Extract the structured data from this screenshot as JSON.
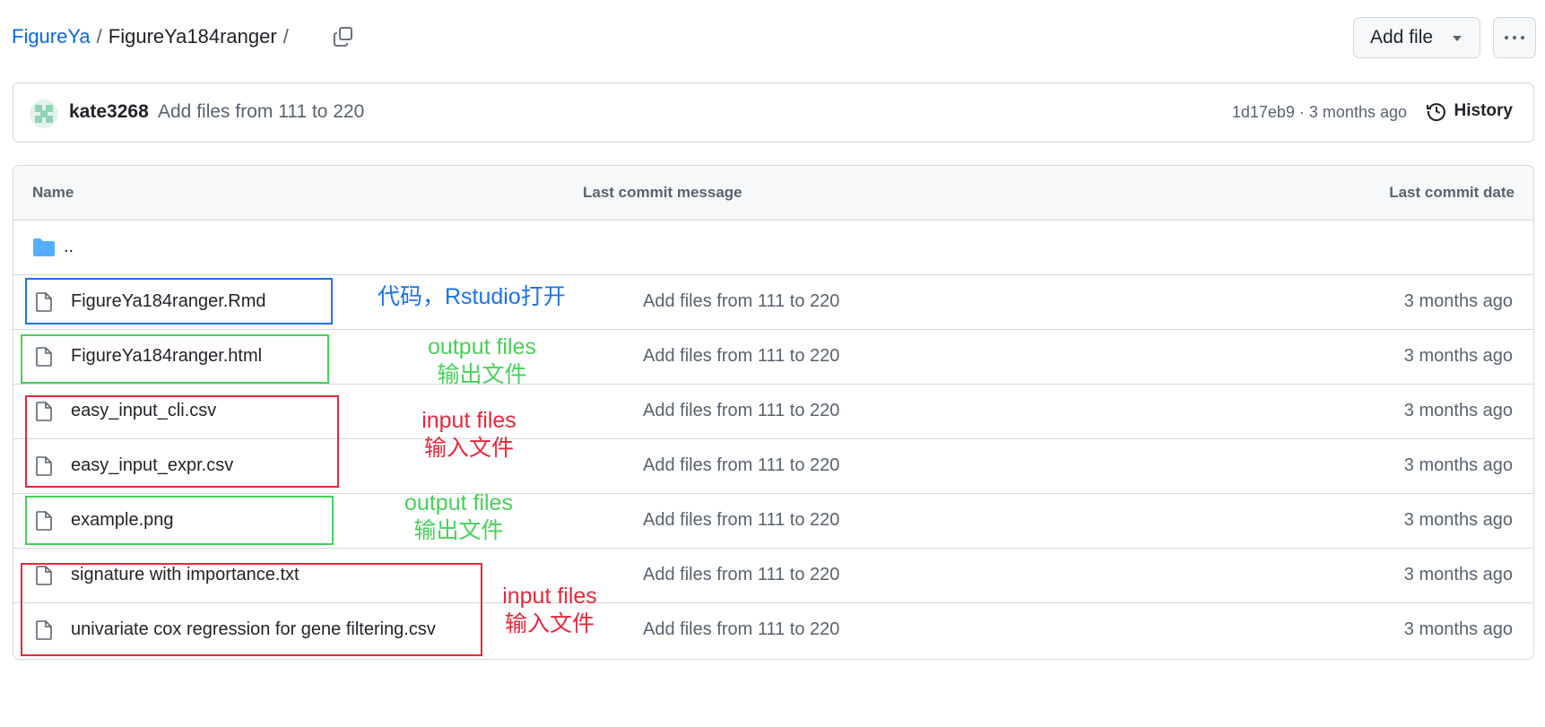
{
  "breadcrumb": {
    "owner": "FigureYa",
    "separator": "/",
    "repo": "FigureYa184ranger"
  },
  "buttons": {
    "add_file": "Add file"
  },
  "commit": {
    "user": "kate3268",
    "message": "Add files from 111 to 220",
    "meta": "1d17eb9 · 3 months ago",
    "history_label": "History"
  },
  "table": {
    "headers": {
      "name": "Name",
      "message": "Last commit message",
      "date": "Last commit date"
    },
    "parent_dir": "..",
    "files": [
      {
        "name": "FigureYa184ranger.Rmd",
        "message": "Add files from 111 to 220",
        "date": "3 months ago"
      },
      {
        "name": "FigureYa184ranger.html",
        "message": "Add files from 111 to 220",
        "date": "3 months ago"
      },
      {
        "name": "easy_input_cli.csv",
        "message": "Add files from 111 to 220",
        "date": "3 months ago"
      },
      {
        "name": "easy_input_expr.csv",
        "message": "Add files from 111 to 220",
        "date": "3 months ago"
      },
      {
        "name": "example.png",
        "message": "Add files from 111 to 220",
        "date": "3 months ago"
      },
      {
        "name": "signature with importance.txt",
        "message": "Add files from 111 to 220",
        "date": "3 months ago"
      },
      {
        "name": "univariate cox regression for gene filtering.csv",
        "message": "Add files from 111 to 220",
        "date": "3 months ago"
      }
    ]
  },
  "annotations": {
    "code": "代码，Rstudio打开",
    "output1": {
      "en": "output files",
      "zh": "输出文件"
    },
    "input1": {
      "en": "input files",
      "zh": "输入文件"
    },
    "output2": {
      "en": "output files",
      "zh": "输出文件"
    },
    "input2": {
      "en": "input files",
      "zh": "输入文件"
    }
  },
  "colors": {
    "link": "#0969da",
    "blue_note": "#1a73e8",
    "green_note": "#48d15a",
    "red_note": "#e8283c",
    "folder": "#54aeff"
  },
  "icons": [
    "copy-icon",
    "caret-down-icon",
    "kebab-icon",
    "history-icon",
    "folder-icon",
    "file-icon"
  ]
}
